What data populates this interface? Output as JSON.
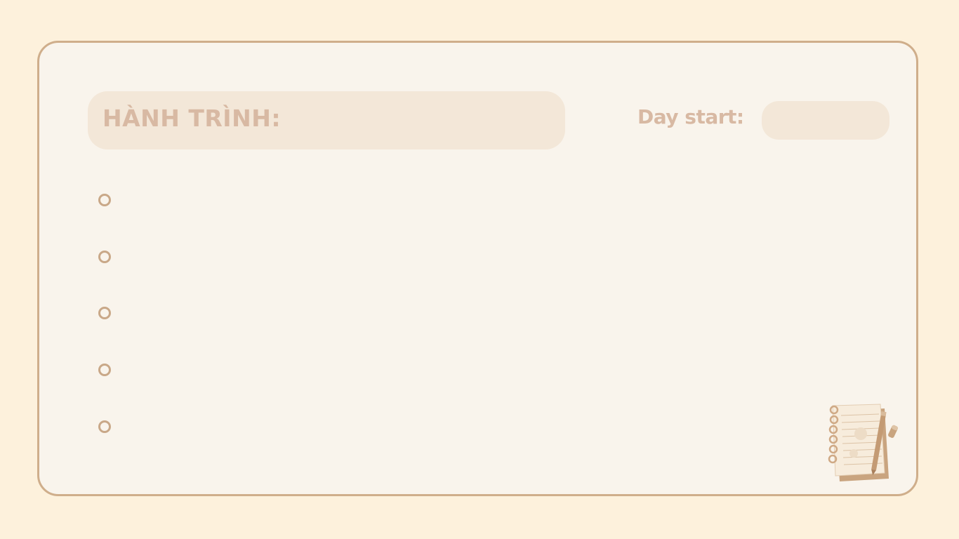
{
  "journey": {
    "title": "HÀNH TRÌNH:"
  },
  "day_start": {
    "label": "Day start:",
    "value": ""
  },
  "entries": [
    {
      "value": ""
    },
    {
      "value": ""
    },
    {
      "value": ""
    },
    {
      "value": ""
    },
    {
      "value": ""
    }
  ],
  "decoration": {
    "icon": "notebook-with-pen-icon"
  },
  "colors": {
    "page_background": "#fdf1dc",
    "card_background": "#f9f4ec",
    "card_border": "#cfae8b",
    "pill_fill": "#f3e7d8",
    "label_text": "#d8b9a3",
    "bullet": "#c9a888"
  }
}
